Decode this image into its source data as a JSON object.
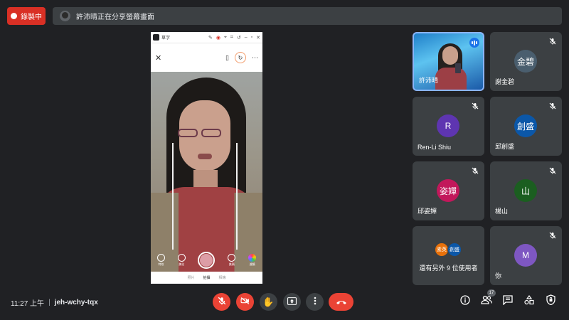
{
  "recording": {
    "label": "錄製中"
  },
  "share_banner": {
    "text": "許沛晴正在分享螢幕畫面"
  },
  "phone_app": {
    "title": "草字",
    "modes": [
      "拍照",
      "影片"
    ],
    "active_mode": "拍照",
    "controls": [
      "特效",
      "美化",
      "",
      "美顏",
      "濾鏡"
    ],
    "tabs": [
      "照片",
      "拍攝",
      "相簿"
    ],
    "active_tab": "拍攝"
  },
  "participants": [
    {
      "name": "許沛晴",
      "type": "video",
      "speaking": true
    },
    {
      "name": "謝金碧",
      "avatar_text": "金碧",
      "avatar_color": "#4a5e6e",
      "muted": true
    },
    {
      "name": "Ren-Li Shiu",
      "avatar_text": "R",
      "avatar_color": "#5e35b1",
      "muted": true
    },
    {
      "name": "邱創盛",
      "avatar_text": "創盛",
      "avatar_color": "#0b57a8",
      "muted": true
    },
    {
      "name": "邱姿嬋",
      "avatar_text": "姿嬋",
      "avatar_color": "#c2185b",
      "muted": true
    },
    {
      "name": "楊山",
      "avatar_text": "山",
      "avatar_color": "#1b5e20",
      "muted": true
    },
    {
      "name": "",
      "type": "others",
      "avatars": [
        {
          "text": "素英",
          "color": "#e8710a"
        },
        {
          "text": "創盛",
          "color": "#0b57a8"
        }
      ],
      "label": "還有另外 9 位使用者"
    },
    {
      "name": "你",
      "avatar_text": "M",
      "avatar_color": "#7e57c2",
      "muted": true
    }
  ],
  "meeting": {
    "time": "11:27 上午",
    "separator": "|",
    "code": "jeh-wchy-tqx"
  },
  "people_count": "17",
  "colors": {
    "background": "#202124",
    "tile": "#3c4043",
    "accent_red": "#ea4335",
    "active_border": "#8ab4f8"
  },
  "icons": [
    "mic-off-icon",
    "camera-off-icon",
    "raise-hand-icon",
    "present-icon",
    "more-options-icon",
    "end-call-icon",
    "info-icon",
    "people-icon",
    "chat-icon",
    "activities-icon",
    "host-controls-icon"
  ]
}
